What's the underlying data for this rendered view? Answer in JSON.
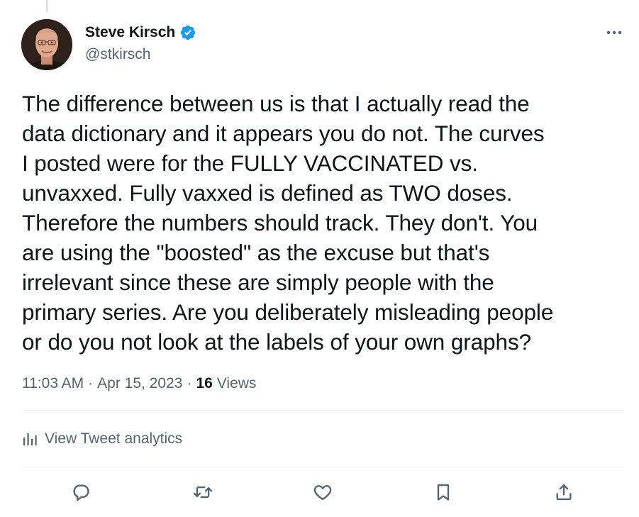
{
  "author": {
    "display_name": "Steve Kirsch",
    "handle": "@stkirsch",
    "verified": true
  },
  "tweet": {
    "text": "The difference between us is that I actually read the\ndata dictionary and it appears you do not. The curves\nI posted were for the FULLY VACCINATED vs.\nunvaxxed. Fully vaxxed is defined as TWO doses.\nTherefore the numbers should track. They don't. You\nare using the \"boosted\" as the excuse but that's\nirrelevant since these are simply people with the\nprimary series. Are you deliberately misleading people\nor do you not look at the labels of your own graphs?",
    "time": "11:03 AM",
    "date": "Apr 15, 2023",
    "separator": "·",
    "views_count": "16",
    "views_label": "Views"
  },
  "analytics": {
    "label": "View Tweet analytics"
  },
  "actions": [
    {
      "name": "reply",
      "icon": "reply-icon"
    },
    {
      "name": "retweet",
      "icon": "retweet-icon"
    },
    {
      "name": "like",
      "icon": "heart-icon"
    },
    {
      "name": "bookmark",
      "icon": "bookmark-icon"
    },
    {
      "name": "share",
      "icon": "share-icon"
    }
  ],
  "colors": {
    "text_primary": "#0f1419",
    "text_secondary": "#536471",
    "verified_blue": "#1d9bf0",
    "divider": "#eff3f4"
  }
}
